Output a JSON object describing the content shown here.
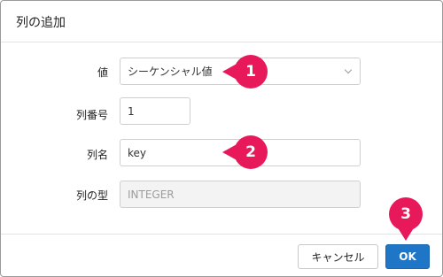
{
  "dialog": {
    "title": "列の追加"
  },
  "form": {
    "value_label": "値",
    "value_selected": "シーケンシャル値",
    "index_label": "列番号",
    "index_value": "1",
    "name_label": "列名",
    "name_value": "key",
    "type_label": "列の型",
    "type_value": "INTEGER"
  },
  "footer": {
    "cancel_label": "キャンセル",
    "ok_label": "OK"
  },
  "callouts": [
    "1",
    "2",
    "3"
  ],
  "colors": {
    "callout": "#e8195b",
    "ok_button": "#1f76c7"
  }
}
